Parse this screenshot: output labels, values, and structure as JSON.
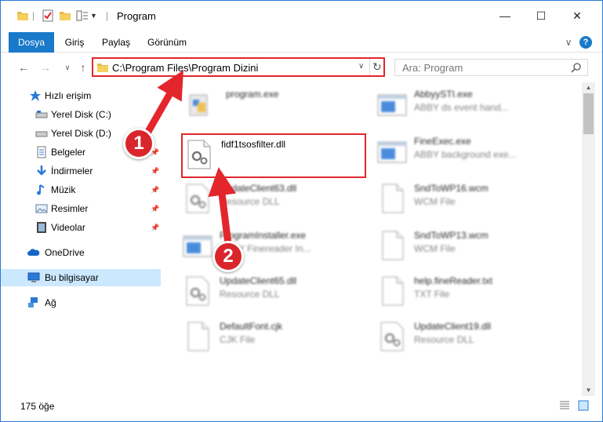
{
  "window": {
    "title": "Program"
  },
  "controls": {
    "minimize": "—",
    "maximize": "☐",
    "close": "✕",
    "help": "?",
    "collapse": "∨"
  },
  "ribbon": {
    "tabs": [
      "Dosya",
      "Giriş",
      "Paylaş",
      "Görünüm"
    ]
  },
  "address": {
    "path": "C:\\Program Files\\Program Dizini",
    "refresh_icon": "↻"
  },
  "search": {
    "placeholder": "Ara: Program"
  },
  "nav": {
    "items": [
      {
        "label": "Hızlı erişim",
        "icon": "star-icon"
      },
      {
        "label": "Yerel Disk (C:)",
        "icon": "drive-icon"
      },
      {
        "label": "Yerel Disk (D:)",
        "icon": "drive-icon"
      },
      {
        "label": "Belgeler",
        "icon": "documents-icon"
      },
      {
        "label": "İndirmeler",
        "icon": "download-icon"
      },
      {
        "label": "Müzik",
        "icon": "music-icon"
      },
      {
        "label": "Resimler",
        "icon": "pictures-icon"
      },
      {
        "label": "Videolar",
        "icon": "video-icon"
      },
      {
        "label": "OneDrive",
        "icon": "cloud-icon"
      },
      {
        "label": "Bu bilgisayar",
        "icon": "computer-icon"
      },
      {
        "label": "Ağ",
        "icon": "network-icon"
      }
    ]
  },
  "files": [
    {
      "name": "program.exe",
      "desc": "",
      "icon": "exe-icon"
    },
    {
      "name": "AbbyySTI.exe",
      "desc": "ABBY ds event hand...",
      "icon": "app-icon"
    },
    {
      "name": "fidf1tsosfilter.dll",
      "desc": "",
      "icon": "dll-icon"
    },
    {
      "name": "FineExec.exe",
      "desc": "ABBY background exe...",
      "icon": "app-icon"
    },
    {
      "name": "UpdateClient63.dll",
      "desc": "Resource DLL",
      "icon": "dll-icon"
    },
    {
      "name": "SndToWP16.wcm",
      "desc": "WCM File",
      "icon": "file-icon"
    },
    {
      "name": "ProgramInstaller.exe",
      "desc": "ABBY Finereader In...",
      "icon": "app-icon"
    },
    {
      "name": "SndToWP13.wcm",
      "desc": "WCM File",
      "icon": "file-icon"
    },
    {
      "name": "UpdateClient65.dll",
      "desc": "Resource DLL",
      "icon": "dll-icon"
    },
    {
      "name": "help.fineReader.txt",
      "desc": "TXT File",
      "icon": "file-icon"
    },
    {
      "name": "DefaultFont.cjk",
      "desc": "CJK File",
      "icon": "file-icon"
    },
    {
      "name": "UpdateClient19.dll",
      "desc": "Resource DLL",
      "icon": "dll-icon"
    }
  ],
  "status": {
    "count": "175 öğe"
  },
  "annotations": {
    "badge1": "1",
    "badge2": "2",
    "color": "#e2262c"
  }
}
